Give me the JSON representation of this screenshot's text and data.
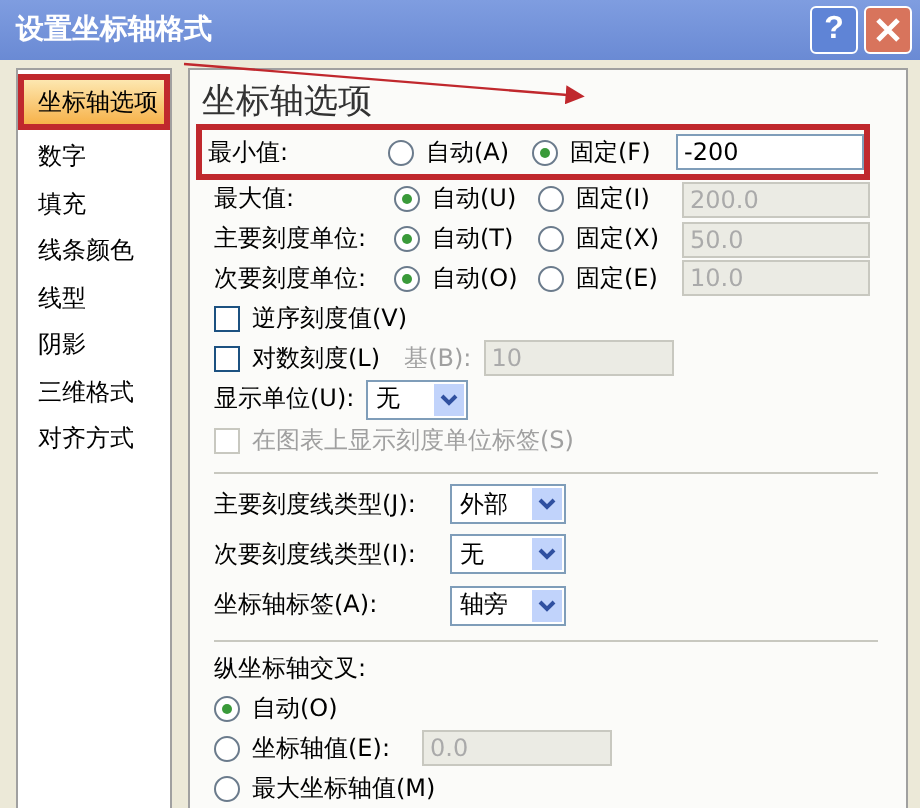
{
  "window": {
    "title": "设置坐标轴格式",
    "help": "?"
  },
  "sidebar": {
    "items": [
      {
        "label": "坐标轴选项",
        "selected": true
      },
      {
        "label": "数字",
        "selected": false
      },
      {
        "label": "填充",
        "selected": false
      },
      {
        "label": "线条颜色",
        "selected": false
      },
      {
        "label": "线型",
        "selected": false
      },
      {
        "label": "阴影",
        "selected": false
      },
      {
        "label": "三维格式",
        "selected": false
      },
      {
        "label": "对齐方式",
        "selected": false
      }
    ]
  },
  "panel": {
    "heading": "坐标轴选项",
    "bounds": [
      {
        "label": "最小值:",
        "auto_label": "自动(A)",
        "fixed_label": "固定(F)",
        "fixed": true,
        "value": "-200",
        "highlighted": true
      },
      {
        "label": "最大值:",
        "auto_label": "自动(U)",
        "fixed_label": "固定(I)",
        "fixed": false,
        "value": "200.0",
        "highlighted": false
      },
      {
        "label": "主要刻度单位:",
        "auto_label": "自动(T)",
        "fixed_label": "固定(X)",
        "fixed": false,
        "value": "50.0",
        "highlighted": false
      },
      {
        "label": "次要刻度单位:",
        "auto_label": "自动(O)",
        "fixed_label": "固定(E)",
        "fixed": false,
        "value": "10.0",
        "highlighted": false
      }
    ],
    "options": [
      {
        "kind": "checkbox",
        "label": "逆序刻度值(V)",
        "checked": false,
        "disabled": false
      },
      {
        "kind": "checkbox",
        "label": "对数刻度(L)",
        "checked": false,
        "disabled": false,
        "base_label": "基(B):",
        "base_value": "10"
      },
      {
        "kind": "select",
        "label": "显示单位(U):",
        "value": "无"
      },
      {
        "kind": "checkbox",
        "label": "在图表上显示刻度单位标签(S)",
        "checked": false,
        "disabled": true
      }
    ],
    "dropdowns": [
      {
        "label": "主要刻度线类型(J):",
        "value": "外部"
      },
      {
        "label": "次要刻度线类型(I):",
        "value": "无"
      },
      {
        "label": "坐标轴标签(A):",
        "value": "轴旁"
      }
    ],
    "cross": {
      "title": "纵坐标轴交叉:",
      "choices": [
        {
          "label": "自动(O)",
          "selected": true
        },
        {
          "label": "坐标轴值(E):",
          "selected": false,
          "value": "0.0"
        },
        {
          "label": "最大坐标轴值(M)",
          "selected": false
        }
      ]
    }
  }
}
